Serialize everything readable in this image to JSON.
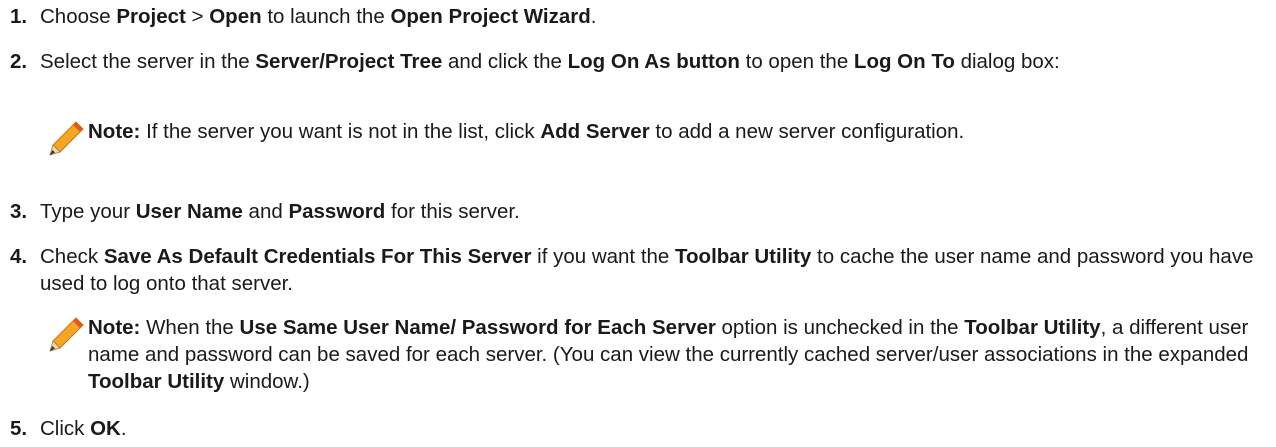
{
  "steps": {
    "s1": {
      "num": "1.",
      "t1": "Choose ",
      "b1": "Project",
      "t2": " > ",
      "b2": "Open",
      "t3": " to launch the ",
      "b3": "Open Project Wizard",
      "t4": "."
    },
    "s2": {
      "num": "2.",
      "t1": "Select the server in the ",
      "b1": "Server/Project Tree",
      "t2": " and click the ",
      "b2": "Log On As button",
      "t3": " to open the ",
      "b3": "Log On To",
      "t4": " dialog box:"
    },
    "n1": {
      "label": "Note:",
      "t1": " If the server you want is not in the list, click ",
      "b1": "Add Server",
      "t2": " to add a new server configuration."
    },
    "s3": {
      "num": "3.",
      "t1": "Type your ",
      "b1": "User Name",
      "t2": " and ",
      "b2": "Password",
      "t3": " for this server."
    },
    "s4": {
      "num": "4.",
      "t1": "Check ",
      "b1": "Save As Default Credentials For This Server",
      "t2": " if you want the ",
      "b2": "Toolbar Utility",
      "t3": " to cache the user name and password you have used to log onto that server."
    },
    "n2": {
      "label": "Note:",
      "t1": " When the ",
      "b1": "Use Same User Name/ Password for Each Server",
      "t2": " option is unchecked in the ",
      "b2": "Toolbar Utility",
      "t3": ", a different user name and password can be saved for each server. (You can view the currently cached server/user associations in the expanded ",
      "b3": "Toolbar Utility",
      "t4": " window.)"
    },
    "s5": {
      "num": "5.",
      "t1": "Click ",
      "b1": "OK",
      "t2": "."
    }
  },
  "icons": {
    "note_icon": "pencil-icon"
  },
  "colors": {
    "pencil_body": "#f5a623",
    "pencil_tip": "#e05a1a",
    "text": "#1a1a1a"
  }
}
